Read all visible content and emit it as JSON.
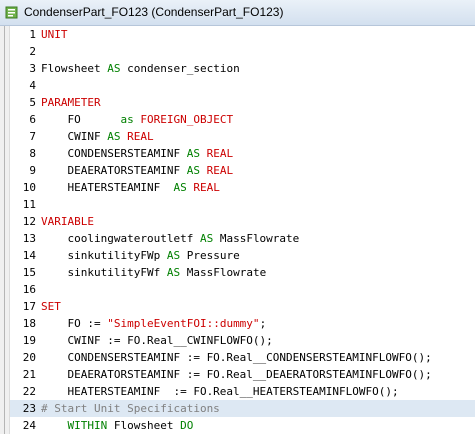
{
  "window": {
    "title": "CondenserPart_FO123  (CondenserPart_FO123)"
  },
  "colors": {
    "keyword": "#cc0000",
    "keyword2": "#008000",
    "comment": "#808080",
    "current_line": "#dde8f3"
  },
  "icons": {
    "app": "document-icon"
  },
  "editor": {
    "lines": [
      {
        "n": "1",
        "t": [
          {
            "c": "kw",
            "s": "UNIT"
          }
        ]
      },
      {
        "n": "2",
        "t": []
      },
      {
        "n": "3",
        "t": [
          {
            "c": "id",
            "s": "Flowsheet "
          },
          {
            "c": "kwg",
            "s": "AS"
          },
          {
            "c": "id",
            "s": " condenser_section"
          }
        ]
      },
      {
        "n": "4",
        "t": []
      },
      {
        "n": "5",
        "t": [
          {
            "c": "kw",
            "s": "PARAMETER"
          }
        ]
      },
      {
        "n": "6",
        "t": [
          {
            "c": "id",
            "s": "    FO      "
          },
          {
            "c": "kwg",
            "s": "as"
          },
          {
            "c": "id",
            "s": " "
          },
          {
            "c": "kw",
            "s": "FOREIGN_OBJECT"
          }
        ]
      },
      {
        "n": "7",
        "t": [
          {
            "c": "id",
            "s": "    CWINF "
          },
          {
            "c": "kwg",
            "s": "AS"
          },
          {
            "c": "id",
            "s": " "
          },
          {
            "c": "kw",
            "s": "REAL"
          }
        ]
      },
      {
        "n": "8",
        "t": [
          {
            "c": "id",
            "s": "    CONDENSERSTEAMINF "
          },
          {
            "c": "kwg",
            "s": "AS"
          },
          {
            "c": "id",
            "s": " "
          },
          {
            "c": "kw",
            "s": "REAL"
          }
        ]
      },
      {
        "n": "9",
        "t": [
          {
            "c": "id",
            "s": "    DEAERATORSTEAMINF "
          },
          {
            "c": "kwg",
            "s": "AS"
          },
          {
            "c": "id",
            "s": " "
          },
          {
            "c": "kw",
            "s": "REAL"
          }
        ]
      },
      {
        "n": "10",
        "t": [
          {
            "c": "id",
            "s": "    HEATERSTEAMINF  "
          },
          {
            "c": "kwg",
            "s": "AS"
          },
          {
            "c": "id",
            "s": " "
          },
          {
            "c": "kw",
            "s": "REAL"
          }
        ]
      },
      {
        "n": "11",
        "t": []
      },
      {
        "n": "12",
        "t": [
          {
            "c": "kw",
            "s": "VARIABLE"
          }
        ]
      },
      {
        "n": "13",
        "t": [
          {
            "c": "id",
            "s": "    coolingwateroutletf "
          },
          {
            "c": "kwg",
            "s": "AS"
          },
          {
            "c": "id",
            "s": " MassFlowrate"
          }
        ]
      },
      {
        "n": "14",
        "t": [
          {
            "c": "id",
            "s": "    sinkutilityFWp "
          },
          {
            "c": "kwg",
            "s": "AS"
          },
          {
            "c": "id",
            "s": " Pressure"
          }
        ]
      },
      {
        "n": "15",
        "t": [
          {
            "c": "id",
            "s": "    sinkutilityFWf "
          },
          {
            "c": "kwg",
            "s": "AS"
          },
          {
            "c": "id",
            "s": " MassFlowrate"
          }
        ]
      },
      {
        "n": "16",
        "t": []
      },
      {
        "n": "17",
        "t": [
          {
            "c": "kw",
            "s": "SET"
          }
        ]
      },
      {
        "n": "18",
        "t": [
          {
            "c": "id",
            "s": "    FO := "
          },
          {
            "c": "str",
            "s": "\"SimpleEventFOI::dummy\""
          },
          {
            "c": "id",
            "s": ";"
          }
        ]
      },
      {
        "n": "19",
        "t": [
          {
            "c": "id",
            "s": "    CWINF := FO.Real__CWINFLOWFO();"
          }
        ]
      },
      {
        "n": "20",
        "t": [
          {
            "c": "id",
            "s": "    CONDENSERSTEAMINF := FO.Real__CONDENSERSTEAMINFLOWFO();"
          }
        ]
      },
      {
        "n": "21",
        "t": [
          {
            "c": "id",
            "s": "    DEAERATORSTEAMINF := FO.Real__DEAERATORSTEAMINFLOWFO();"
          }
        ]
      },
      {
        "n": "22",
        "t": [
          {
            "c": "id",
            "s": "    HEATERSTEAMINF  := FO.Real__HEATERSTEAMINFLOWFO();"
          }
        ]
      },
      {
        "n": "23",
        "t": [
          {
            "c": "cmt",
            "s": "# Start Unit Specifications"
          }
        ],
        "current": true
      },
      {
        "n": "24",
        "t": [
          {
            "c": "id",
            "s": "    "
          },
          {
            "c": "kwg",
            "s": "WITHIN"
          },
          {
            "c": "id",
            "s": " Flowsheet "
          },
          {
            "c": "kwg",
            "s": "DO"
          }
        ]
      }
    ]
  }
}
